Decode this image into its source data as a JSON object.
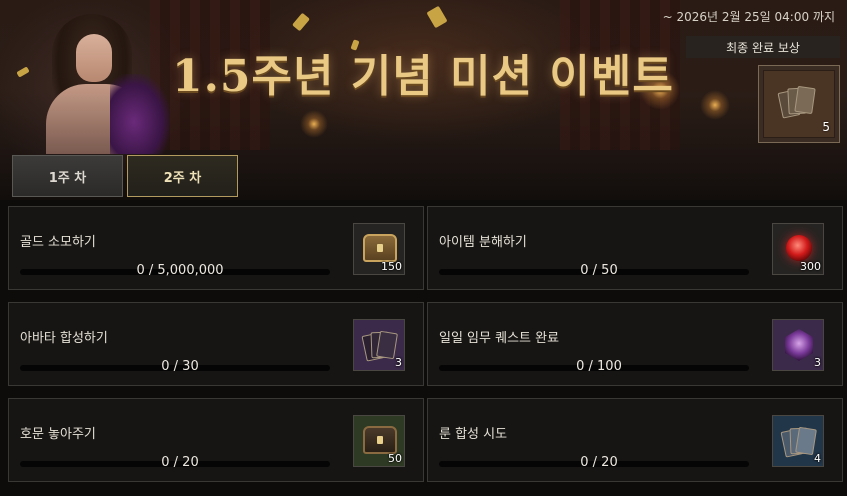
{
  "banner": {
    "title": "1.5주년 기념 미션 이벤트",
    "deadline": "~ 2026년 2월 25일 04:00 까지"
  },
  "final_reward": {
    "label": "최종 완료 보상",
    "quantity": "5",
    "icon": "card-bundle-icon"
  },
  "tabs": [
    {
      "label": "1주 차",
      "selected": false
    },
    {
      "label": "2주 차",
      "selected": true
    }
  ],
  "missions": [
    {
      "name": "골드 소모하기",
      "progress": "0 / 5,000,000",
      "reward_qty": "150",
      "reward_icon": "gold-chest-icon"
    },
    {
      "name": "아이템 분해하기",
      "progress": "0 / 50",
      "reward_qty": "300",
      "reward_icon": "red-orb-icon"
    },
    {
      "name": "아바타 합성하기",
      "progress": "0 / 30",
      "reward_qty": "3",
      "reward_icon": "avatar-card-icon"
    },
    {
      "name": "일일 임무 퀘스트 완료",
      "progress": "0 / 100",
      "reward_qty": "3",
      "reward_icon": "purple-emblem-icon"
    },
    {
      "name": "호문 놓아주기",
      "progress": "0 / 20",
      "reward_qty": "50",
      "reward_icon": "wooden-chest-icon"
    },
    {
      "name": "룬 합성 시도",
      "progress": "0 / 20",
      "reward_qty": "4",
      "reward_icon": "rune-card-icon"
    }
  ],
  "colors": {
    "title_gold": "#e9c983",
    "selected_tab_border": "#b39a5e",
    "panel_bg": "#161514"
  }
}
